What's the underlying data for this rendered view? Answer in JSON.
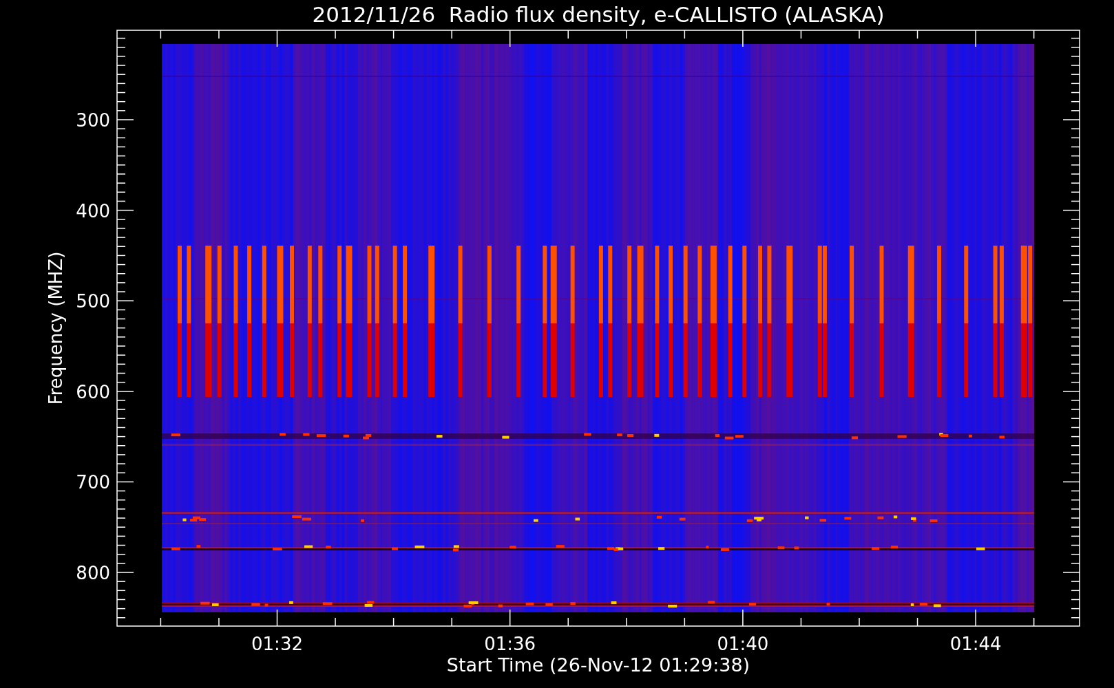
{
  "title": "2012/11/26  Radio flux density, e-CALLISTO (ALASKA)",
  "y_axis": {
    "label": "Frequency (MHZ)",
    "ticks": [
      "300",
      "400",
      "500",
      "600",
      "700",
      "800"
    ]
  },
  "x_axis": {
    "label": "Start Time (26-Nov-12 01:29:38)",
    "ticks": [
      "01:32",
      "01:36",
      "01:40",
      "01:44"
    ]
  }
}
